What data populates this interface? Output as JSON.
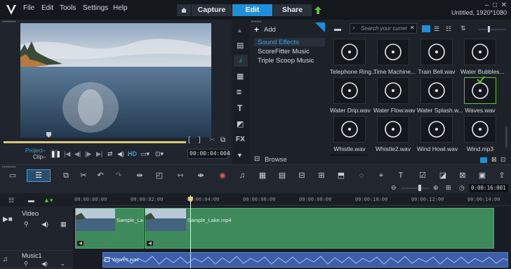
{
  "menu": [
    "File",
    "Edit",
    "Tools",
    "Settings",
    "Help"
  ],
  "mode_tabs": [
    "Capture",
    "Edit",
    "Share"
  ],
  "project_info": "Untitled, 1920*1080",
  "preview": {
    "project_label": "Project–",
    "clip_label": "Clip–",
    "hd_label": "HD",
    "timecode": "00:00:04:004"
  },
  "library": {
    "add_label": "Add",
    "categories": [
      "Sound Effects",
      "ScoreFitter Music",
      "Triple Scoop Music"
    ],
    "browse_label": "Browse",
    "search_placeholder": "Search your current...",
    "tiles": [
      "Telephone Ring...",
      "Time Machine...",
      "Train Bell.wav",
      "Water Bubbles...",
      "Water Drip.wav",
      "Water Flow.wav",
      "Water Splash.w...",
      "Waves.wav",
      "Whistle.wav",
      "Whistle2.wav",
      "Wind Howl.wav",
      "Wind.mp3"
    ]
  },
  "timeline": {
    "zoom_timecode": "0:00:16:001",
    "ruler": [
      "00:00:00:00",
      "00:00:02:00",
      "00:00:04:00",
      "00:00:06:00",
      "00:00:08:00",
      "00:00:10:00",
      "00:00:12:00",
      "00:00:14:00"
    ],
    "tracks": {
      "video_name": "Video",
      "music_name": "Music1"
    },
    "clips": {
      "video_a": "Sample_Lak",
      "video_b": "Sample_Lake.mp4",
      "audio": "Waves.wav"
    }
  }
}
